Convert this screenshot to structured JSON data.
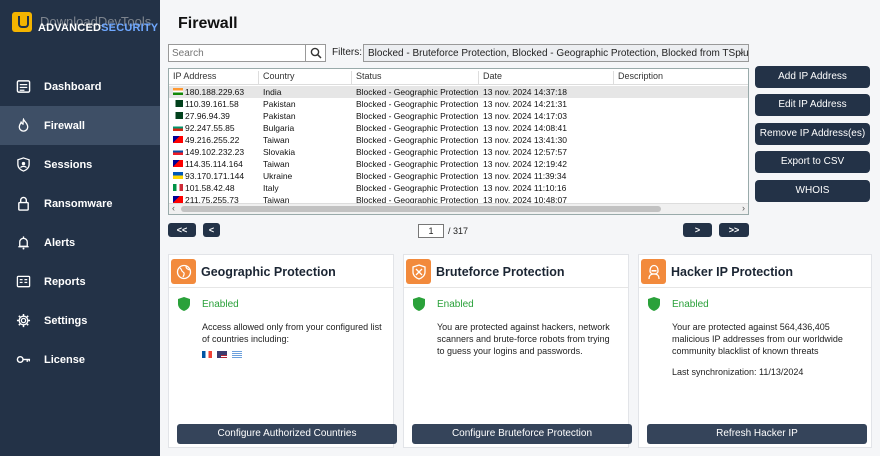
{
  "app": {
    "logo_text_a": "ADVANCED",
    "logo_text_b": "SECURITY",
    "watermark": "DownloadDevTools",
    "brand_color": "#233247",
    "accent_orange": "#f28a3c",
    "enabled_green": "#2aa13a"
  },
  "sidebar": {
    "items": [
      {
        "label": "Dashboard",
        "icon": "dashboard-icon"
      },
      {
        "label": "Firewall",
        "icon": "fire-icon",
        "active": true
      },
      {
        "label": "Sessions",
        "icon": "shield-user-icon"
      },
      {
        "label": "Ransomware",
        "icon": "lock-icon"
      },
      {
        "label": "Alerts",
        "icon": "bell-icon"
      },
      {
        "label": "Reports",
        "icon": "report-icon"
      },
      {
        "label": "Settings",
        "icon": "gear-icon"
      },
      {
        "label": "License",
        "icon": "key-icon"
      }
    ]
  },
  "page": {
    "title": "Firewall",
    "search_placeholder": "Search",
    "filters_label": "Filters:",
    "filters_value": "Blocked - Bruteforce Protection, Blocked - Geographic Protection, Blocked from TSplus A"
  },
  "table": {
    "columns": [
      "IP Address",
      "Country",
      "Status",
      "Date",
      "Description"
    ],
    "rows": [
      {
        "ip": "180.188.229.63",
        "country": "India",
        "status": "Blocked - Geographic Protection",
        "date": "13 nov. 2024 14:37:18",
        "flag": "in"
      },
      {
        "ip": "110.39.161.58",
        "country": "Pakistan",
        "status": "Blocked - Geographic Protection",
        "date": "13 nov. 2024 14:21:31",
        "flag": "pk"
      },
      {
        "ip": "27.96.94.39",
        "country": "Pakistan",
        "status": "Blocked - Geographic Protection",
        "date": "13 nov. 2024 14:17:03",
        "flag": "pk"
      },
      {
        "ip": "92.247.55.85",
        "country": "Bulgaria",
        "status": "Blocked - Geographic Protection",
        "date": "13 nov. 2024 14:08:41",
        "flag": "bg"
      },
      {
        "ip": "49.216.255.22",
        "country": "Taiwan",
        "status": "Blocked - Geographic Protection",
        "date": "13 nov. 2024 13:41:30",
        "flag": "tw"
      },
      {
        "ip": "149.102.232.23",
        "country": "Slovakia",
        "status": "Blocked - Geographic Protection",
        "date": "13 nov. 2024 12:57:57",
        "flag": "sk"
      },
      {
        "ip": "114.35.114.164",
        "country": "Taiwan",
        "status": "Blocked - Geographic Protection",
        "date": "13 nov. 2024 12:19:42",
        "flag": "tw"
      },
      {
        "ip": "93.170.171.144",
        "country": "Ukraine",
        "status": "Blocked - Geographic Protection",
        "date": "13 nov. 2024 11:39:34",
        "flag": "ua"
      },
      {
        "ip": "101.58.42.48",
        "country": "Italy",
        "status": "Blocked - Geographic Protection",
        "date": "13 nov. 2024 11:10:16",
        "flag": "it"
      },
      {
        "ip": "211.75.255.73",
        "country": "Taiwan",
        "status": "Blocked - Geographic Protection",
        "date": "13 nov. 2024 10:48:07",
        "flag": "tw"
      }
    ]
  },
  "pager": {
    "first": "<<",
    "prev": "<",
    "next": ">",
    "last": ">>",
    "current_page": "1",
    "total": "/ 317"
  },
  "actions": [
    "Add IP Address",
    "Edit IP Address",
    "Remove IP Address(es)",
    "Export to CSV",
    "WHOIS"
  ],
  "cards": [
    {
      "title": "Geographic Protection",
      "status": "Enabled",
      "desc": "Access allowed only from your configured list of countries including:",
      "button": "Configure Authorized Countries",
      "icon": "globe-icon"
    },
    {
      "title": "Bruteforce Protection",
      "status": "Enabled",
      "desc": "You are protected against hackers, network scanners and brute-force robots from trying to guess your logins and passwords.",
      "button": "Configure Bruteforce Protection",
      "icon": "shield-block-icon"
    },
    {
      "title": "Hacker IP Protection",
      "status": "Enabled",
      "desc": "Your are protected against 564,436,405 malicious IP addresses from our worldwide community blacklist of known threats",
      "desc2": "Last synchronization: 11/13/2024",
      "button": "Refresh Hacker IP",
      "icon": "hacker-icon"
    }
  ]
}
